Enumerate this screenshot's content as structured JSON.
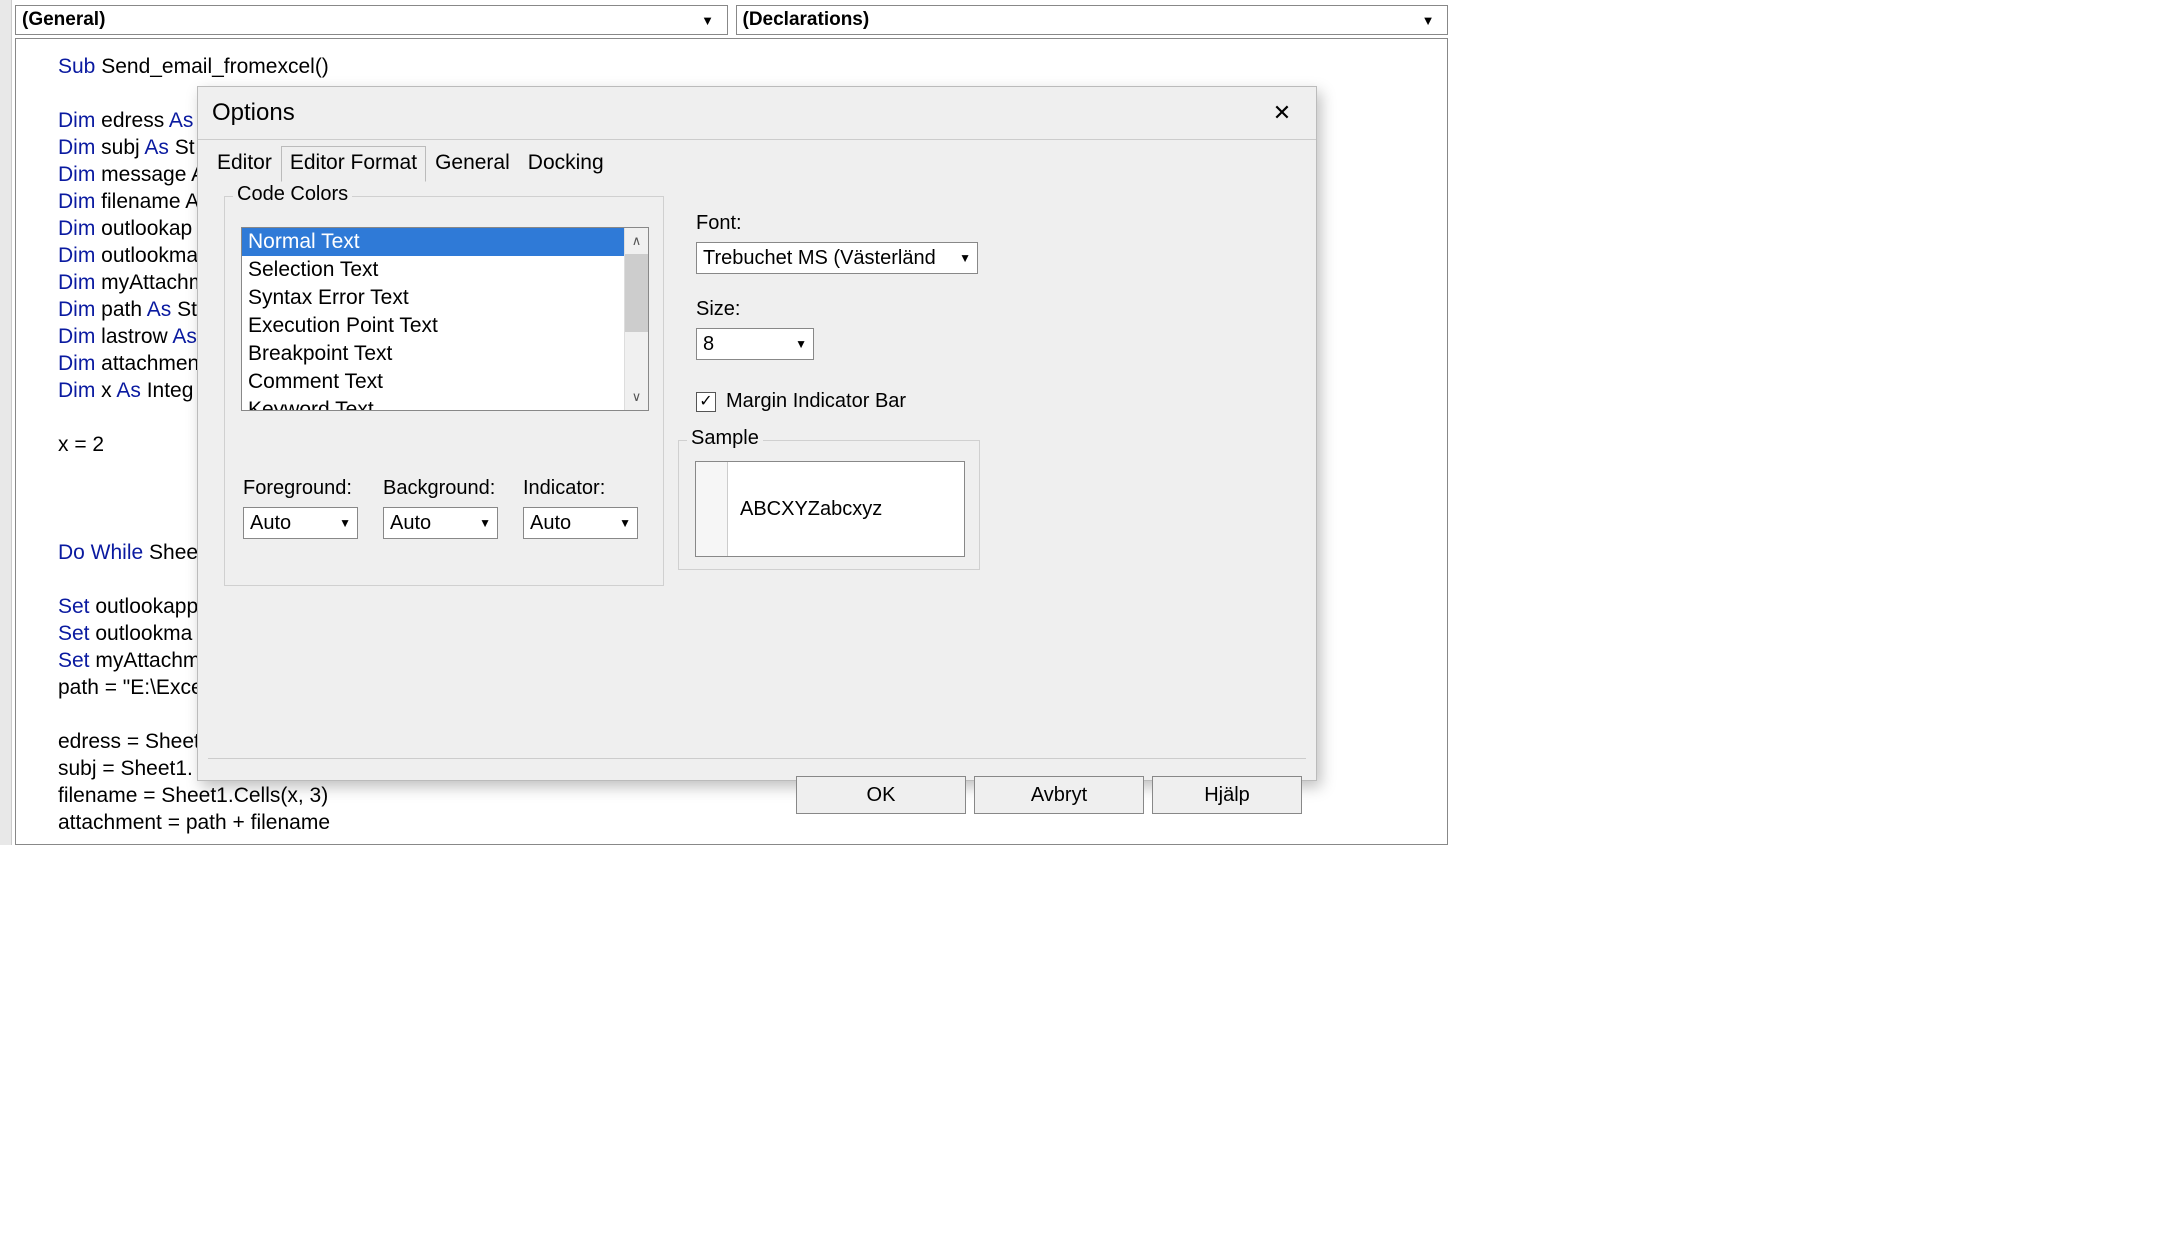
{
  "topbar": {
    "object_combo": "(General)",
    "proc_combo": "(Declarations)"
  },
  "code": {
    "lines": [
      [
        [
          "kw",
          "Sub"
        ],
        [
          "plain",
          " Send_email_fromexcel()"
        ]
      ],
      [],
      [
        [
          "kw",
          "Dim"
        ],
        [
          "plain",
          " edress "
        ],
        [
          "kw",
          "As"
        ],
        [
          "plain",
          " "
        ]
      ],
      [
        [
          "kw",
          "Dim"
        ],
        [
          "plain",
          " subj "
        ],
        [
          "kw",
          "As"
        ],
        [
          "plain",
          " St"
        ]
      ],
      [
        [
          "kw",
          "Dim"
        ],
        [
          "plain",
          " message "
        ],
        [
          "plain",
          "A"
        ]
      ],
      [
        [
          "kw",
          "Dim"
        ],
        [
          "plain",
          " filename "
        ],
        [
          "plain",
          "A"
        ]
      ],
      [
        [
          "kw",
          "Dim"
        ],
        [
          "plain",
          " outlookap"
        ]
      ],
      [
        [
          "kw",
          "Dim"
        ],
        [
          "plain",
          " outlookma"
        ]
      ],
      [
        [
          "kw",
          "Dim"
        ],
        [
          "plain",
          " myAttachm"
        ]
      ],
      [
        [
          "kw",
          "Dim"
        ],
        [
          "plain",
          " path "
        ],
        [
          "kw",
          "As"
        ],
        [
          "plain",
          " St"
        ]
      ],
      [
        [
          "kw",
          "Dim"
        ],
        [
          "plain",
          " lastrow "
        ],
        [
          "kw",
          "As"
        ]
      ],
      [
        [
          "kw",
          "Dim"
        ],
        [
          "plain",
          " attachmen"
        ]
      ],
      [
        [
          "kw",
          "Dim"
        ],
        [
          "plain",
          " x "
        ],
        [
          "kw",
          "As"
        ],
        [
          "plain",
          " Integ"
        ]
      ],
      [],
      [
        [
          "plain",
          "x = 2"
        ]
      ],
      [],
      [],
      [],
      [
        [
          "kw",
          "Do While"
        ],
        [
          "plain",
          " Shee"
        ]
      ],
      [],
      [
        [
          "kw",
          "Set"
        ],
        [
          "plain",
          " outlookapp"
        ]
      ],
      [
        [
          "kw",
          "Set"
        ],
        [
          "plain",
          " outlookma"
        ]
      ],
      [
        [
          "kw",
          "Set"
        ],
        [
          "plain",
          " myAttachm"
        ]
      ],
      [
        [
          "plain",
          "path = \"E:\\Exce"
        ]
      ],
      [],
      [
        [
          "plain",
          "edress = Sheet"
        ]
      ],
      [
        [
          "plain",
          "subj = Sheet1."
        ]
      ],
      [
        [
          "plain",
          "filename = Sheet1.Cells(x, 3)"
        ]
      ],
      [
        [
          "plain",
          "attachment = path + filename"
        ]
      ]
    ]
  },
  "dialog": {
    "title": "Options",
    "tabs": [
      "Editor",
      "Editor Format",
      "General",
      "Docking"
    ],
    "active_tab": 1,
    "code_colors": {
      "legend": "Code Colors",
      "items": [
        "Normal Text",
        "Selection Text",
        "Syntax Error Text",
        "Execution Point Text",
        "Breakpoint Text",
        "Comment Text",
        "Keyword Text"
      ],
      "selected_index": 0,
      "foreground_label": "Foreground:",
      "background_label": "Background:",
      "indicator_label": "Indicator:",
      "foreground_value": "Auto",
      "background_value": "Auto",
      "indicator_value": "Auto"
    },
    "font_label": "Font:",
    "font_value": "Trebuchet MS (Västerländ",
    "size_label": "Size:",
    "size_value": "8",
    "margin_checkbox_label": "Margin Indicator Bar",
    "margin_checked": true,
    "sample_legend": "Sample",
    "sample_text": "ABCXYZabcxyz",
    "buttons": {
      "ok": "OK",
      "cancel": "Avbryt",
      "help": "Hjälp"
    }
  }
}
